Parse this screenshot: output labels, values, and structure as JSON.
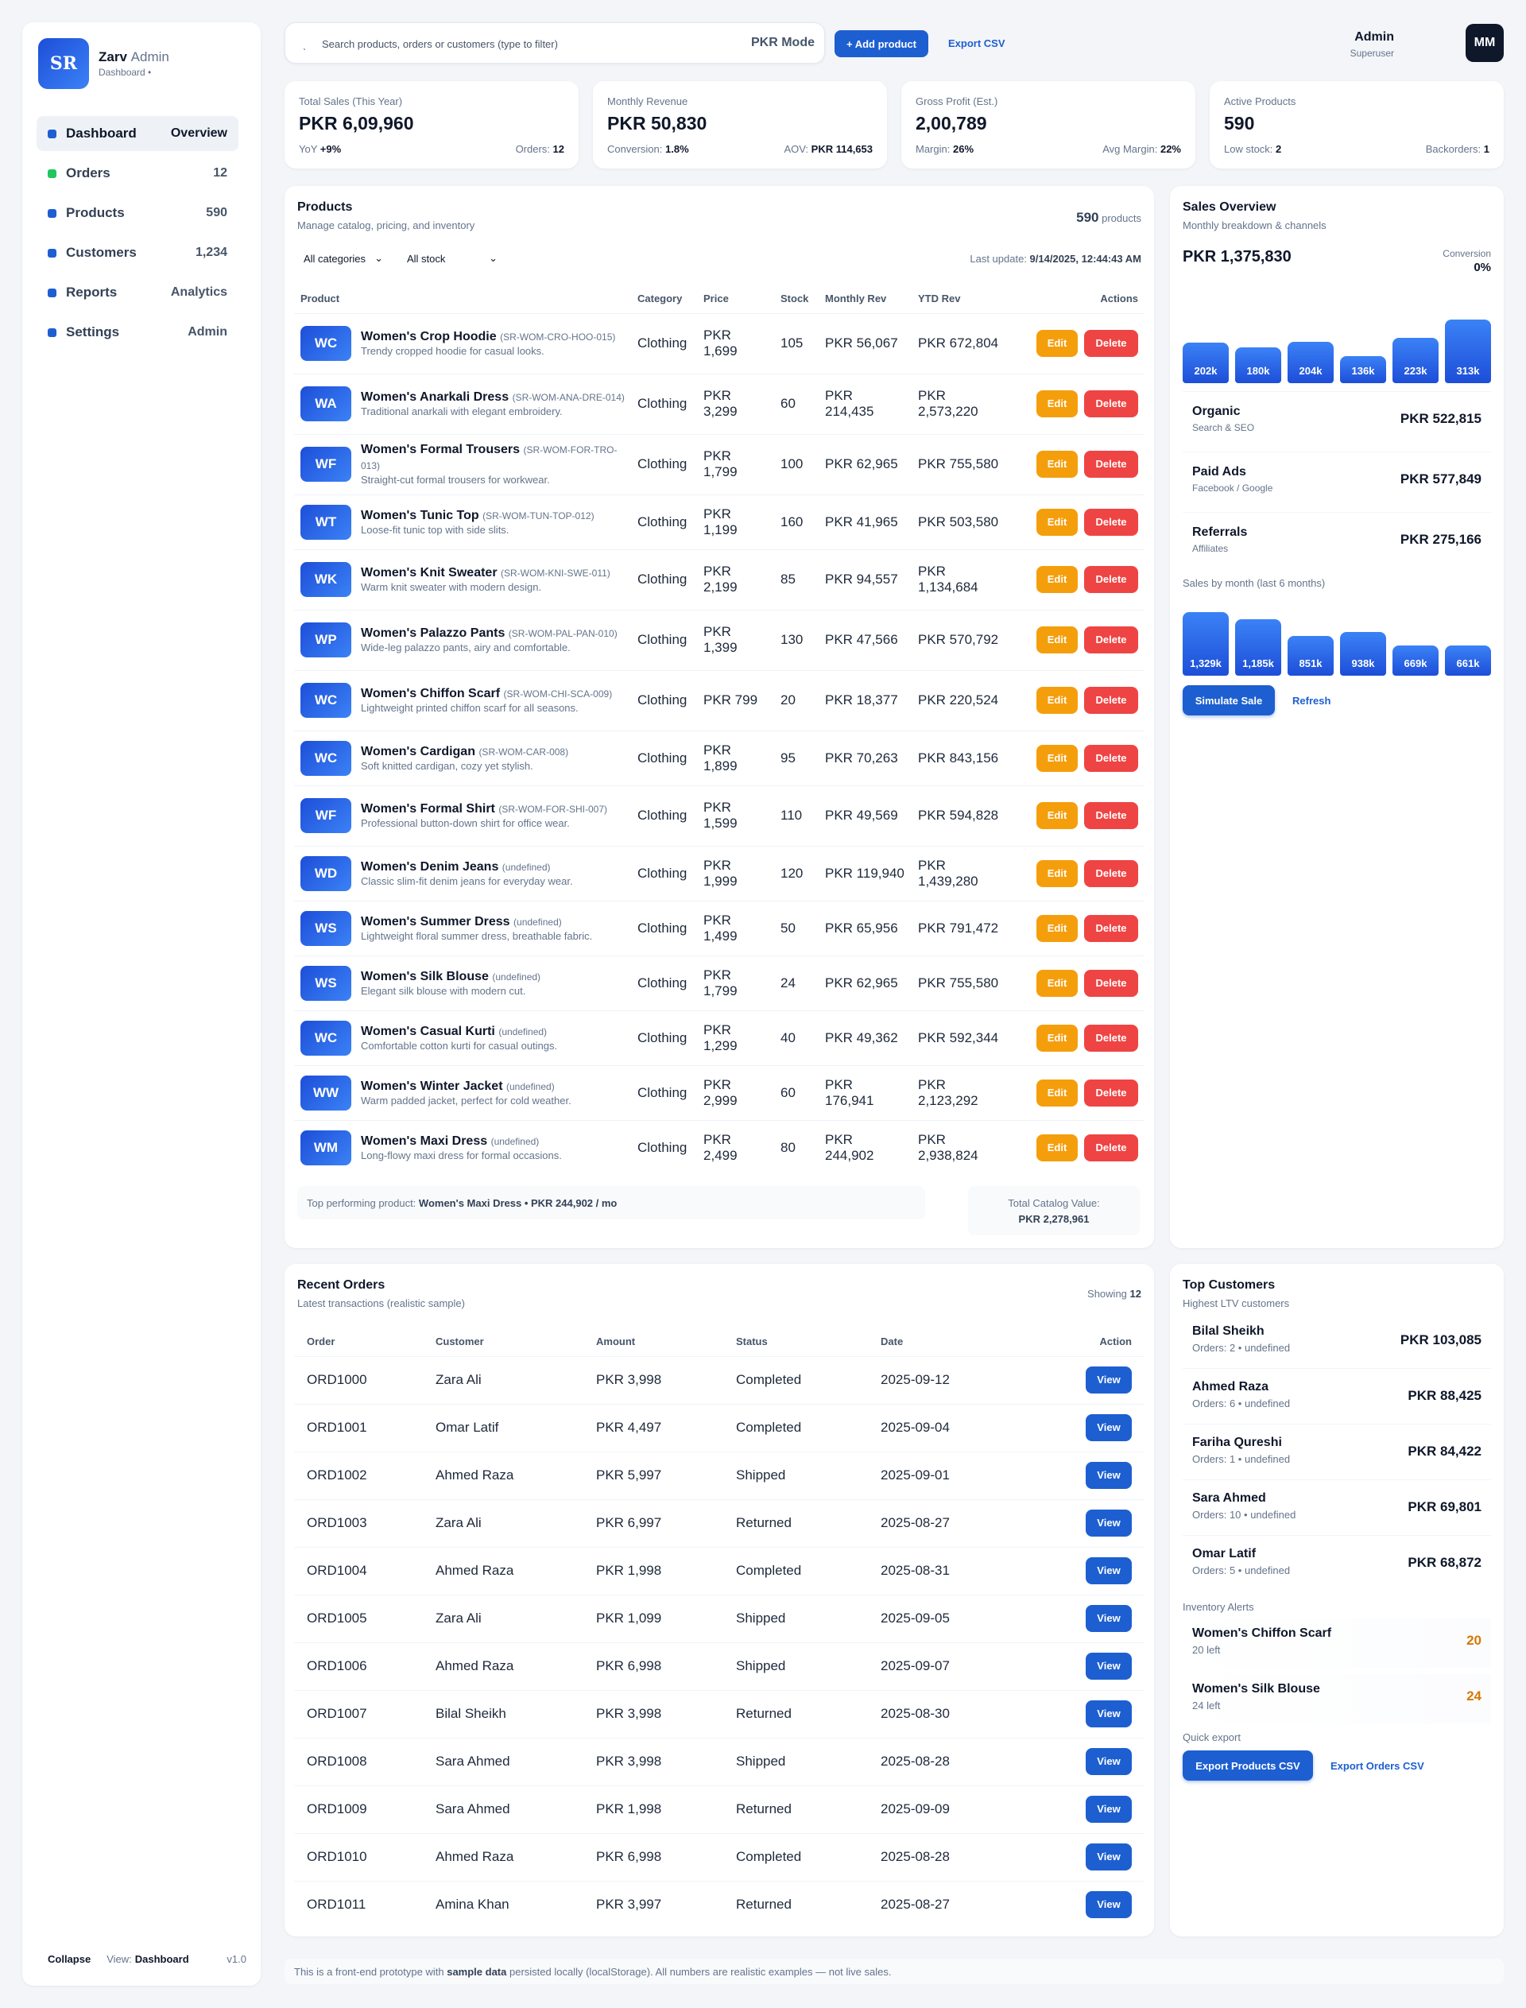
{
  "sidebar": {
    "logo": "SR",
    "brand_name": "Zarv",
    "brand_suffix": "Admin",
    "brand_sub": "Dashboard •",
    "items": [
      {
        "label": "Dashboard",
        "meta": "Overview"
      },
      {
        "label": "Orders",
        "meta": "12"
      },
      {
        "label": "Products",
        "meta": "590"
      },
      {
        "label": "Customers",
        "meta": "1,234"
      },
      {
        "label": "Reports",
        "meta": "Analytics"
      },
      {
        "label": "Settings",
        "meta": "Admin"
      }
    ],
    "collapse": "Collapse",
    "view_prefix": "View:",
    "view_value": "Dashboard",
    "version": "v1.0"
  },
  "topbar": {
    "search_icon": "search-icon",
    "search_placeholder": "Search products, orders or customers (type to filter)",
    "mode": "PKR Mode",
    "add_product": "+ Add product",
    "export_csv": "Export CSV",
    "admin_name": "Admin",
    "admin_role": "Superuser",
    "avatar": "MM"
  },
  "stats": [
    {
      "label": "Total Sales (This Year)",
      "value": "PKR 6,09,960",
      "l_key": "YoY",
      "l_val": "+9%",
      "r_key": "Orders:",
      "r_val": "12"
    },
    {
      "label": "Monthly Revenue",
      "value": "PKR 50,830",
      "l_key": "Conversion:",
      "l_val": "1.8%",
      "r_key": "AOV:",
      "r_val": "PKR 114,653"
    },
    {
      "label": "Gross Profit (Est.)",
      "value": "2,00,789",
      "l_key": "Margin:",
      "l_val": "26%",
      "r_key": "Avg Margin:",
      "r_val": "22%"
    },
    {
      "label": "Active Products",
      "value": "590",
      "l_key": "Low stock:",
      "l_val": "2",
      "r_key": "Backorders:",
      "r_val": "1"
    }
  ],
  "products": {
    "title": "Products",
    "subtitle": "Manage catalog, pricing, and inventory",
    "count": "590",
    "count_label": "products",
    "filter_category": "All categories",
    "filter_stock": "All stock",
    "last_update_label": "Last update:",
    "last_update": "9/14/2025, 12:44:43 AM",
    "columns": [
      "Product",
      "Category",
      "Price",
      "Stock",
      "Monthly Rev",
      "YTD Rev",
      "Actions"
    ],
    "edit_label": "Edit",
    "delete_label": "Delete",
    "rows": [
      {
        "badge": "WC",
        "name": "Women's Crop Hoodie",
        "sku": "(SR-WOM-CRO-HOO-015)",
        "desc": "Trendy cropped hoodie for casual looks.",
        "category": "Clothing",
        "price": "PKR 1,699",
        "stock": "105",
        "monthly": "PKR 56,067",
        "ytd": "PKR 672,804"
      },
      {
        "badge": "WA",
        "name": "Women's Anarkali Dress",
        "sku": "(SR-WOM-ANA-DRE-014)",
        "desc": "Traditional anarkali with elegant embroidery.",
        "category": "Clothing",
        "price": "PKR 3,299",
        "stock": "60",
        "monthly": "PKR 214,435",
        "ytd": "PKR 2,573,220"
      },
      {
        "badge": "WF",
        "name": "Women's Formal Trousers",
        "sku": "(SR-WOM-FOR-TRO-013)",
        "desc": "Straight-cut formal trousers for workwear.",
        "category": "Clothing",
        "price": "PKR 1,799",
        "stock": "100",
        "monthly": "PKR 62,965",
        "ytd": "PKR 755,580"
      },
      {
        "badge": "WT",
        "name": "Women's Tunic Top",
        "sku": "(SR-WOM-TUN-TOP-012)",
        "desc": "Loose-fit tunic top with side slits.",
        "category": "Clothing",
        "price": "PKR 1,199",
        "stock": "160",
        "monthly": "PKR 41,965",
        "ytd": "PKR 503,580"
      },
      {
        "badge": "WK",
        "name": "Women's Knit Sweater",
        "sku": "(SR-WOM-KNI-SWE-011)",
        "desc": "Warm knit sweater with modern design.",
        "category": "Clothing",
        "price": "PKR 2,199",
        "stock": "85",
        "monthly": "PKR 94,557",
        "ytd": "PKR 1,134,684"
      },
      {
        "badge": "WP",
        "name": "Women's Palazzo Pants",
        "sku": "(SR-WOM-PAL-PAN-010)",
        "desc": "Wide-leg palazzo pants, airy and comfortable.",
        "category": "Clothing",
        "price": "PKR 1,399",
        "stock": "130",
        "monthly": "PKR 47,566",
        "ytd": "PKR 570,792"
      },
      {
        "badge": "WC",
        "name": "Women's Chiffon Scarf",
        "sku": "(SR-WOM-CHI-SCA-009)",
        "desc": "Lightweight printed chiffon scarf for all seasons.",
        "category": "Clothing",
        "price": "PKR 799",
        "stock": "20",
        "monthly": "PKR 18,377",
        "ytd": "PKR 220,524"
      },
      {
        "badge": "WC",
        "name": "Women's Cardigan",
        "sku": "(SR-WOM-CAR-008)",
        "desc": "Soft knitted cardigan, cozy yet stylish.",
        "category": "Clothing",
        "price": "PKR 1,899",
        "stock": "95",
        "monthly": "PKR 70,263",
        "ytd": "PKR 843,156"
      },
      {
        "badge": "WF",
        "name": "Women's Formal Shirt",
        "sku": "(SR-WOM-FOR-SHI-007)",
        "desc": "Professional button-down shirt for office wear.",
        "category": "Clothing",
        "price": "PKR 1,599",
        "stock": "110",
        "monthly": "PKR 49,569",
        "ytd": "PKR 594,828"
      },
      {
        "badge": "WD",
        "name": "Women's Denim Jeans",
        "sku": "(undefined)",
        "desc": "Classic slim-fit denim jeans for everyday wear.",
        "category": "Clothing",
        "price": "PKR 1,999",
        "stock": "120",
        "monthly": "PKR 119,940",
        "ytd": "PKR 1,439,280"
      },
      {
        "badge": "WS",
        "name": "Women's Summer Dress",
        "sku": "(undefined)",
        "desc": "Lightweight floral summer dress, breathable fabric.",
        "category": "Clothing",
        "price": "PKR 1,499",
        "stock": "50",
        "monthly": "PKR 65,956",
        "ytd": "PKR 791,472"
      },
      {
        "badge": "WS",
        "name": "Women's Silk Blouse",
        "sku": "(undefined)",
        "desc": "Elegant silk blouse with modern cut.",
        "category": "Clothing",
        "price": "PKR 1,799",
        "stock": "24",
        "monthly": "PKR 62,965",
        "ytd": "PKR 755,580"
      },
      {
        "badge": "WC",
        "name": "Women's Casual Kurti",
        "sku": "(undefined)",
        "desc": "Comfortable cotton kurti for casual outings.",
        "category": "Clothing",
        "price": "PKR 1,299",
        "stock": "40",
        "monthly": "PKR 49,362",
        "ytd": "PKR 592,344"
      },
      {
        "badge": "WW",
        "name": "Women's Winter Jacket",
        "sku": "(undefined)",
        "desc": "Warm padded jacket, perfect for cold weather.",
        "category": "Clothing",
        "price": "PKR 2,999",
        "stock": "60",
        "monthly": "PKR 176,941",
        "ytd": "PKR 2,123,292"
      },
      {
        "badge": "WM",
        "name": "Women's Maxi Dress",
        "sku": "(undefined)",
        "desc": "Long-flowy maxi dress for formal occasions.",
        "category": "Clothing",
        "price": "PKR 2,499",
        "stock": "80",
        "monthly": "PKR 244,902",
        "ytd": "PKR 2,938,824"
      }
    ],
    "top_label": "Top performing product:",
    "top_value": "Women's Maxi Dress • PKR 244,902 / mo",
    "catalog_label": "Total Catalog Value:",
    "catalog_value": "PKR 2,278,961"
  },
  "sales": {
    "title": "Sales Overview",
    "subtitle": "Monthly breakdown & channels",
    "total": "PKR 1,375,830",
    "conversion_label": "Conversion",
    "conversion_value": "0%",
    "top_bars": [
      {
        "label": "202k",
        "value": 202
      },
      {
        "label": "180k",
        "value": 180
      },
      {
        "label": "204k",
        "value": 204
      },
      {
        "label": "136k",
        "value": 136
      },
      {
        "label": "223k",
        "value": 223
      },
      {
        "label": "313k",
        "value": 313
      }
    ],
    "channels": [
      {
        "name": "Organic",
        "sub": "Search & SEO",
        "value": "PKR 522,815"
      },
      {
        "name": "Paid Ads",
        "sub": "Facebook / Google",
        "value": "PKR 577,849"
      },
      {
        "name": "Referrals",
        "sub": "Affiliates",
        "value": "PKR 275,166"
      }
    ],
    "by_month_label": "Sales by month (last 6 months)",
    "month_bars": [
      {
        "label": "1,329k",
        "value": 1329
      },
      {
        "label": "1,185k",
        "value": 1185
      },
      {
        "label": "851k",
        "value": 851
      },
      {
        "label": "938k",
        "value": 938
      },
      {
        "label": "669k",
        "value": 669
      },
      {
        "label": "661k",
        "value": 661
      }
    ],
    "simulate": "Simulate Sale",
    "refresh": "Refresh"
  },
  "orders": {
    "title": "Recent Orders",
    "subtitle": "Latest transactions (realistic sample)",
    "showing_label": "Showing",
    "showing_value": "12",
    "columns": [
      "Order",
      "Customer",
      "Amount",
      "Status",
      "Date",
      "Action"
    ],
    "view_label": "View",
    "rows": [
      {
        "id": "ORD1000",
        "customer": "Zara Ali",
        "amount": "PKR 3,998",
        "status": "Completed",
        "date": "2025-09-12"
      },
      {
        "id": "ORD1001",
        "customer": "Omar Latif",
        "amount": "PKR 4,497",
        "status": "Completed",
        "date": "2025-09-04"
      },
      {
        "id": "ORD1002",
        "customer": "Ahmed Raza",
        "amount": "PKR 5,997",
        "status": "Shipped",
        "date": "2025-09-01"
      },
      {
        "id": "ORD1003",
        "customer": "Zara Ali",
        "amount": "PKR 6,997",
        "status": "Returned",
        "date": "2025-08-27"
      },
      {
        "id": "ORD1004",
        "customer": "Ahmed Raza",
        "amount": "PKR 1,998",
        "status": "Completed",
        "date": "2025-08-31"
      },
      {
        "id": "ORD1005",
        "customer": "Zara Ali",
        "amount": "PKR 1,099",
        "status": "Shipped",
        "date": "2025-09-05"
      },
      {
        "id": "ORD1006",
        "customer": "Ahmed Raza",
        "amount": "PKR 6,998",
        "status": "Shipped",
        "date": "2025-09-07"
      },
      {
        "id": "ORD1007",
        "customer": "Bilal Sheikh",
        "amount": "PKR 3,998",
        "status": "Returned",
        "date": "2025-08-30"
      },
      {
        "id": "ORD1008",
        "customer": "Sara Ahmed",
        "amount": "PKR 3,998",
        "status": "Shipped",
        "date": "2025-08-28"
      },
      {
        "id": "ORD1009",
        "customer": "Sara Ahmed",
        "amount": "PKR 1,998",
        "status": "Returned",
        "date": "2025-09-09"
      },
      {
        "id": "ORD1010",
        "customer": "Ahmed Raza",
        "amount": "PKR 6,998",
        "status": "Completed",
        "date": "2025-08-28"
      },
      {
        "id": "ORD1011",
        "customer": "Amina Khan",
        "amount": "PKR 3,997",
        "status": "Returned",
        "date": "2025-08-27"
      }
    ]
  },
  "customers": {
    "title": "Top Customers",
    "subtitle": "Highest LTV customers",
    "list": [
      {
        "name": "Bilal Sheikh",
        "sub": "Orders: 2 • undefined",
        "value": "PKR 103,085"
      },
      {
        "name": "Ahmed Raza",
        "sub": "Orders: 6 • undefined",
        "value": "PKR 88,425"
      },
      {
        "name": "Fariha Qureshi",
        "sub": "Orders: 1 • undefined",
        "value": "PKR 84,422"
      },
      {
        "name": "Sara Ahmed",
        "sub": "Orders: 10 • undefined",
        "value": "PKR 69,801"
      },
      {
        "name": "Omar Latif",
        "sub": "Orders: 5 • undefined",
        "value": "PKR 68,872"
      }
    ],
    "alerts_label": "Inventory Alerts",
    "alerts": [
      {
        "name": "Women's Chiffon Scarf",
        "sub": "20 left",
        "value": "20"
      },
      {
        "name": "Women's Silk Blouse",
        "sub": "24 left",
        "value": "24"
      }
    ],
    "quick_export_label": "Quick export",
    "export_products": "Export Products CSV",
    "export_orders": "Export Orders CSV"
  },
  "footer": {
    "prefix": "This is a front-end prototype with",
    "bold": "sample data",
    "suffix": "persisted locally (localStorage). All numbers are realistic examples — not live sales."
  }
}
